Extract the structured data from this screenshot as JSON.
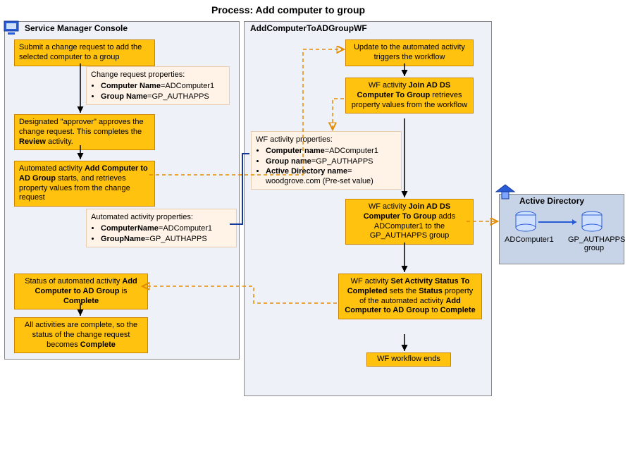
{
  "title": "Process: Add computer to group",
  "groups": {
    "smc": {
      "label": "Service Manager Console"
    },
    "wf": {
      "label": "AddComputerToADGroupWF"
    },
    "ad": {
      "label": "Active Directory"
    }
  },
  "smc": {
    "submit": "Submit a change request to add the selected computer to a group",
    "cr_props_title": "Change request properties:",
    "cr_prop1_key": "Computer Name",
    "cr_prop1_val": "=ADComputer1",
    "cr_prop2_key": "Group Name",
    "cr_prop2_val": "=GP_AUTHAPPS",
    "approve_pre": "Designated \"approver\" approves the change request. This completes the ",
    "approve_bold": "Review",
    "approve_post": " activity.",
    "auto_pre": "Automated activity ",
    "auto_bold": "Add Computer to AD Group",
    "auto_post": " starts, and retrieves property values from the change request",
    "aa_props_title": "Automated activity properties:",
    "aa_prop1_key": "ComputerName",
    "aa_prop1_val": "=ADComputer1",
    "aa_prop2_key": "GroupName",
    "aa_prop2_val": "=GP_AUTHAPPS",
    "status_pre": "Status of automated activity ",
    "status_bold1": "Add Computer to AD Group",
    "status_mid": " is ",
    "status_bold2": "Complete",
    "complete_pre": "All activities are complete, so the status of the change request becomes ",
    "complete_bold": "Complete"
  },
  "wf": {
    "trigger": "Update to the automated activity triggers the workflow",
    "join1_pre": "WF activity ",
    "join1_bold": "Join AD DS Computer To Group",
    "join1_post": " retrieves property values from the workflow",
    "wf_props_title": "WF activity properties:",
    "wf_prop1_key": "Computer name",
    "wf_prop1_val": "=ADComputer1",
    "wf_prop2_key": "Group name",
    "wf_prop2_val": "=GP_AUTHAPPS",
    "wf_prop3_key": "Active Directory name",
    "wf_prop3_val": "= woodgrove.com (Pre-set value)",
    "join2_pre": "WF activity ",
    "join2_bold": "Join AD DS Computer To Group",
    "join2_post": " adds ADComputer1 to the GP_AUTHAPPS group",
    "setstat_pre": "WF activity ",
    "setstat_bold1": "Set Activity Status To Completed",
    "setstat_mid1": " sets the ",
    "setstat_bold2": "Status",
    "setstat_mid2": " property of the automated activity ",
    "setstat_bold3": "Add Computer to AD Group",
    "setstat_mid3": " to ",
    "setstat_bold4": "Complete",
    "end": "WF workflow ends"
  },
  "ad": {
    "computer": "ADComputer1",
    "group": "GP_AUTHAPPS group"
  }
}
